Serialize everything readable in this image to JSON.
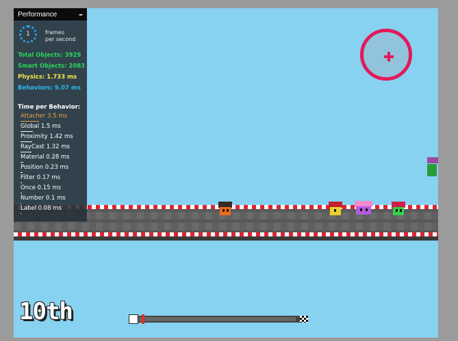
{
  "performance": {
    "title": "Performance",
    "collapse_symbol": "–",
    "fps": {
      "value": "1",
      "label_line1": "frames",
      "label_line2": "per second"
    },
    "total_objects": "Total Objects: 3929",
    "smart_objects": "Smart Objects: 2083",
    "physics": "Physics: 1.733 ms",
    "behaviors": "Behaviors: 9.07 ms",
    "time_per_behavior_title": "Time per Behavior:",
    "behavior_items": [
      {
        "label": "Attacher 3.5 ms",
        "share": 0.45
      },
      {
        "label": "Global 1.5 ms",
        "share": 0.3
      },
      {
        "label": "Proximity 1.42 ms",
        "share": 0.28
      },
      {
        "label": "RayCast 1.32 ms",
        "share": 0.27
      },
      {
        "label": "Material 0.28 ms",
        "share": 0.06
      },
      {
        "label": "Position 0.23 ms",
        "share": 0.05
      },
      {
        "label": "Filter 0.17 ms",
        "share": 0.04
      },
      {
        "label": "Once 0.15 ms",
        "share": 0.03
      },
      {
        "label": "Number 0.1 ms",
        "share": 0.02
      },
      {
        "label": "Label 0.08 ms",
        "share": 0.02
      }
    ]
  },
  "hud": {
    "rank": "10th",
    "progress": 0.02
  },
  "colors": {
    "sky": "#87d2f0",
    "crosshair": "#e3195a",
    "stripe_red": "#e0242f"
  }
}
